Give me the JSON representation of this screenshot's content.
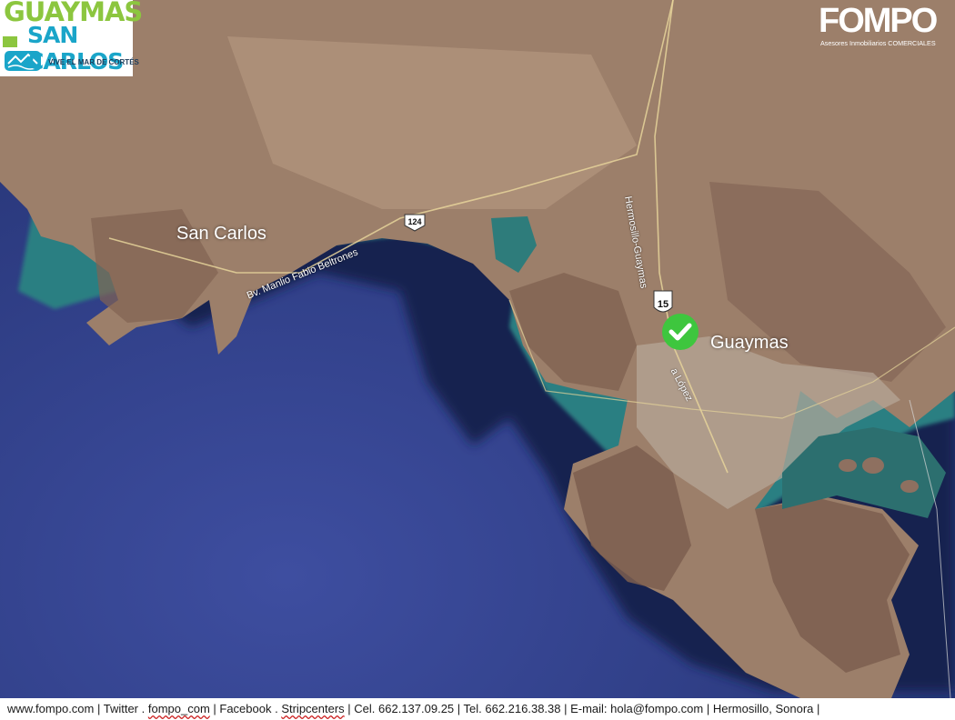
{
  "logo": {
    "line1": "GUAYMAS",
    "line2": "SAN CARLOS",
    "tagline": "VIVE EL MAR DE CORTÉS"
  },
  "brand": {
    "name": "FOMPO",
    "subtitle": "Asesores Inmobiliarios COMERCIALES"
  },
  "map": {
    "places": {
      "san_carlos": "San Carlos",
      "guaymas": "Guaymas"
    },
    "roads": {
      "blvd": "Bv. Manlio Fabio Beltrones",
      "hermosillo": "Hermosillo-Guaymas",
      "lopez": "a López"
    },
    "shields": {
      "route_124": "124",
      "route_15": "15"
    },
    "marker_icon": "check-circle-icon",
    "colors": {
      "marker": "#3ec63e",
      "deep_sea": "#2a3680",
      "shallow_sea": "#2f8f8a",
      "land": "#9b7e69"
    }
  },
  "footer": {
    "web": "www.fompo.com | Twitter . ",
    "twitter": "fompo_com",
    "facebook_lead": " |  Facebook . ",
    "facebook": "Stripcenters",
    "rest": " | Cel. 662.137.09.25 | Tel. 662.216.38.38 | E-mail: hola@fompo.com | Hermosillo, Sonora |"
  }
}
